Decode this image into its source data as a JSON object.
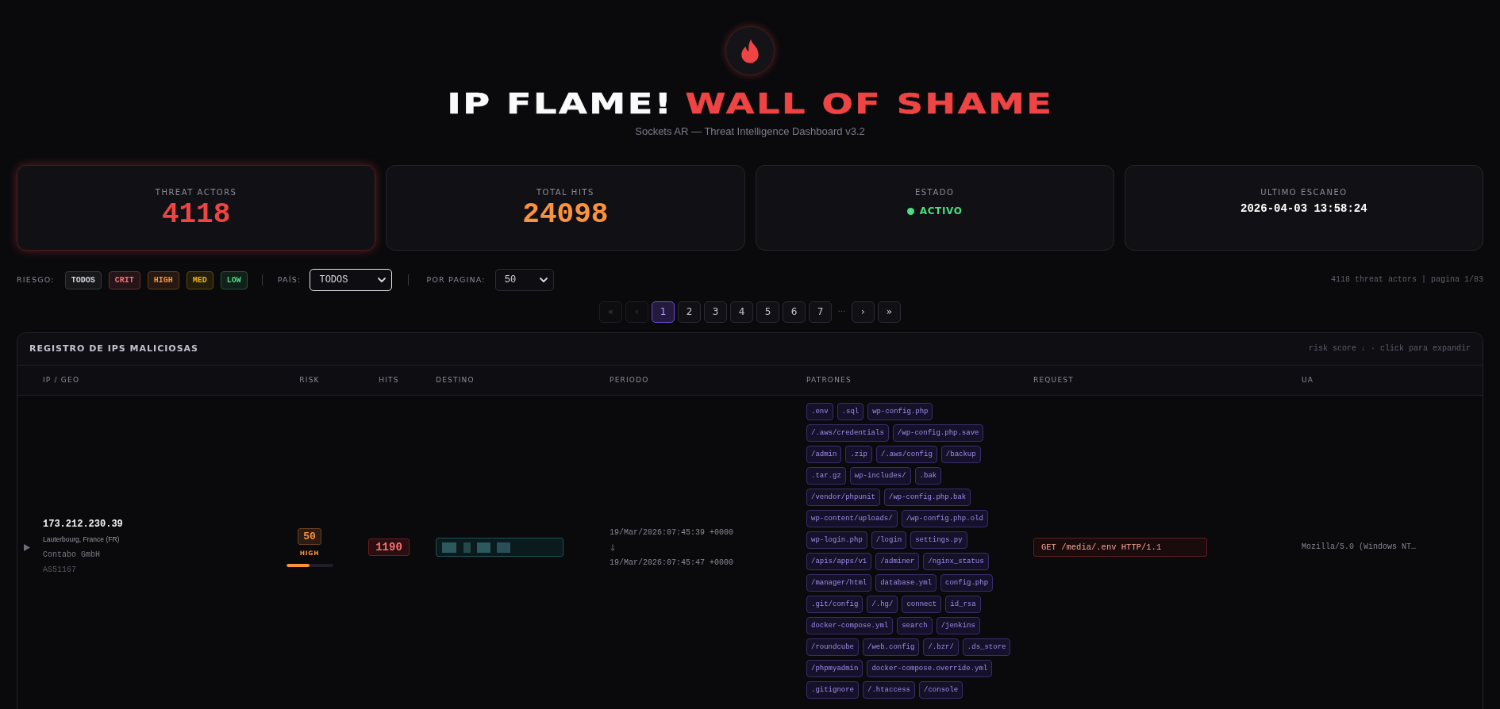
{
  "header": {
    "title": "IP FLAME!",
    "title_accent": "WALL OF SHAME",
    "subtitle": "Sockets AR — Threat Intelligence Dashboard v3.2"
  },
  "stats": [
    {
      "kind": "number",
      "label": "THREAT ACTORS",
      "value": "4118",
      "color": "#ef4444",
      "highlighted": true
    },
    {
      "kind": "number",
      "label": "TOTAL HITS",
      "value": "24098",
      "color": "#fb923c",
      "highlighted": false
    },
    {
      "kind": "status",
      "label": "ESTADO",
      "value": "ACTIVO",
      "color": "#4ade80",
      "highlighted": false
    },
    {
      "kind": "timestamp",
      "label": "ULTIMO ESCANEO",
      "value": "2026-04-03 13:58:24",
      "color": "#ffffff",
      "highlighted": false
    }
  ],
  "filters": {
    "risk": {
      "label": "RIESGO:",
      "options": [
        {
          "label": "TODOS",
          "color": "#d1d5db",
          "selected": true
        },
        {
          "label": "CRIT",
          "color": "#f87171",
          "selected": false
        },
        {
          "label": "HIGH",
          "color": "#fb923c",
          "selected": false
        },
        {
          "label": "MED",
          "color": "#eab308",
          "selected": false
        },
        {
          "label": "LOW",
          "color": "#4ade80",
          "selected": false
        }
      ]
    },
    "country": {
      "label": "PAÍS:",
      "value": "TODOS",
      "focused": true
    },
    "per_page": {
      "label": "POR PAGINA:",
      "value": "50",
      "focused": false
    },
    "summary": "4118 threat actors | pagina 1/83"
  },
  "pagination": [
    {
      "kind": "first",
      "label": "«",
      "disabled": true
    },
    {
      "kind": "previous",
      "label": "‹",
      "disabled": true
    },
    {
      "kind": "page",
      "label": "1",
      "selected": true
    },
    {
      "kind": "page",
      "label": "2",
      "selected": false
    },
    {
      "kind": "page",
      "label": "3",
      "selected": false
    },
    {
      "kind": "page",
      "label": "4",
      "selected": false
    },
    {
      "kind": "page",
      "label": "5",
      "selected": false
    },
    {
      "kind": "page",
      "label": "6",
      "selected": false
    },
    {
      "kind": "page",
      "label": "7",
      "selected": false
    },
    {
      "kind": "ellipsis",
      "label": "…"
    },
    {
      "kind": "next",
      "label": "›",
      "disabled": false
    },
    {
      "kind": "last",
      "label": "»",
      "disabled": false
    }
  ],
  "table": {
    "title": "REGISTRO DE IPS MALICIOSAS",
    "hint": "risk score ↓ · click para expandir",
    "columns": [
      "IP / GEO",
      "RISK",
      "HITS",
      "DESTINO",
      "PERIODO",
      "PATRONES",
      "REQUEST",
      "UA"
    ],
    "rows": [
      {
        "expanded": false,
        "ip": "173.212.230.39",
        "location": "Lauterbourg, France (FR)",
        "org": "Contabo GmbH",
        "asn": "AS51167",
        "risk": {
          "score": "50",
          "label": "HIGH",
          "level": 0.5,
          "color": "#fb923c"
        },
        "hits": "1190",
        "destination": {
          "redacted": true
        },
        "period": {
          "from": "19/Mar/2026:07:45:39 +0000",
          "to": "19/Mar/2026:07:45:47 +0000"
        },
        "patterns": [
          ".env",
          ".sql",
          "wp-config.php",
          "/.aws/credentials",
          "/wp-config.php.save",
          "/admin",
          ".zip",
          "/.aws/config",
          "/backup",
          ".tar.gz",
          "wp-includes/",
          ".bak",
          "/vendor/phpunit",
          "/wp-config.php.bak",
          "wp-content/uploads/",
          "/wp-config.php.old",
          "wp-login.php",
          "/login",
          "settings.py",
          "/apis/apps/v1",
          "/adminer",
          "/nginx_status",
          "/manager/html",
          "database.yml",
          "config.php",
          ".git/config",
          "/.hg/",
          "connect",
          "id_rsa",
          "docker-compose.yml",
          "search",
          "/jenkins",
          "/roundcube",
          "/web.config",
          "/.bzr/",
          ".ds_store",
          "/phpmyadmin",
          "docker-compose.override.yml",
          ".gitignore",
          "/.htaccess",
          "/console"
        ],
        "request": "GET /media/.env HTTP/1.1",
        "user_agent": "Mozilla/5.0 (Windows NT…"
      }
    ]
  }
}
